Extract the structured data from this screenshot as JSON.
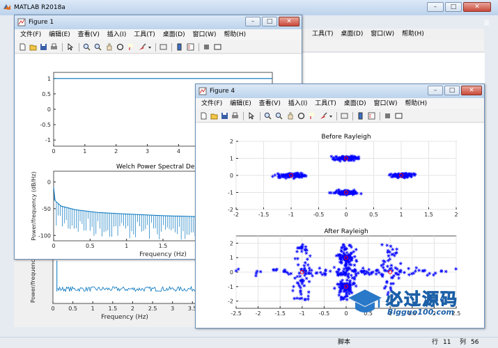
{
  "matlab": {
    "title": "MATLAB R2018a",
    "menu": [
      "工具(T)",
      "桌面(D)",
      "窗口(W)",
      "帮助(H)"
    ],
    "status": {
      "script": "脚本",
      "row_label": "行",
      "row": "11",
      "col_label": "列",
      "col": "56"
    },
    "side_text": "录"
  },
  "figure1": {
    "title": "Figure 1",
    "menu": [
      "文件(F)",
      "编辑(E)",
      "查看(V)",
      "插入(I)",
      "工具(T)",
      "桌面(D)",
      "窗口(W)",
      "帮助(H)"
    ]
  },
  "figure4": {
    "title": "Figure 4",
    "menu": [
      "文件(F)",
      "编辑(E)",
      "查看(V)",
      "插入(I)",
      "工具(T)",
      "桌面(D)",
      "窗口(W)",
      "帮助(H)"
    ]
  },
  "watermark": {
    "text": "必过源码",
    "url": "Bigguo100.com"
  },
  "colors": {
    "line": "#0072bd",
    "scatter": "#0000ff",
    "marker": "#ff0000",
    "frame": "#6b8fb5"
  },
  "chart_data": [
    {
      "id": "fig1-top",
      "type": "line",
      "x": [
        0,
        7
      ],
      "y": [
        1,
        1
      ],
      "xticks": [
        "0",
        "1",
        "2",
        "3",
        "4",
        "5",
        "6"
      ],
      "yticks": [
        "-1",
        "-0.5",
        "0",
        "0.5",
        "1"
      ],
      "xlim": [
        0,
        7
      ],
      "ylim": [
        -1.2,
        1.2
      ]
    },
    {
      "id": "fig1-psd",
      "type": "line",
      "title": "Welch Power Spectral Density",
      "xlabel": "Frequency (Hz)",
      "ylabel": "Power/frequency (dB/Hz)",
      "xticks": [
        "0",
        "0.5",
        "1",
        "1.5",
        "2",
        "2.5",
        "3"
      ],
      "yticks": [
        "-100",
        "-50",
        "0"
      ],
      "xlim": [
        0,
        3
      ],
      "ylim": [
        -110,
        20
      ],
      "series": [
        {
          "x": [
            0,
            0.02,
            0.1,
            0.3,
            0.6,
            1.0,
            1.5,
            2.0,
            2.5,
            3.0
          ],
          "y": [
            -10,
            -35,
            -45,
            -52,
            -57,
            -60,
            -63,
            -65,
            -66,
            -67
          ]
        }
      ]
    },
    {
      "id": "main-bottom",
      "type": "line",
      "xlabel": "Frequency (Hz)",
      "ylabel": "Power/frequenc",
      "xticks": [
        "0",
        "0.5",
        "1",
        "1.5",
        "2",
        "2.5",
        "3",
        "3.5"
      ],
      "xlim": [
        0,
        3.6
      ],
      "ylim": [
        -130,
        0
      ],
      "series": [
        {
          "x": [
            0,
            3.6
          ],
          "y": [
            -88,
            -88
          ]
        }
      ]
    },
    {
      "id": "fig4-before",
      "type": "scatter",
      "title": "Before Rayleigh",
      "xticks": [
        "-2",
        "-1.5",
        "-1",
        "-0.5",
        "0",
        "0.5",
        "1",
        "1.5",
        "2"
      ],
      "yticks": [
        "-2",
        "-1",
        "0",
        "1",
        "2"
      ],
      "xlim": [
        -2,
        2
      ],
      "ylim": [
        -2,
        2
      ],
      "clusters": [
        {
          "x": -1,
          "y": 0
        },
        {
          "x": 1,
          "y": 0
        },
        {
          "x": 0,
          "y": 1
        },
        {
          "x": 0,
          "y": -1
        }
      ]
    },
    {
      "id": "fig4-after",
      "type": "scatter",
      "title": "After Rayleigh",
      "xticks": [
        "-2.5",
        "-2",
        "-1.5",
        "-1",
        "-0.5",
        "0",
        "0.5",
        "1",
        "1.5",
        "2",
        "2.5"
      ],
      "yticks": [
        "-2",
        "-1",
        "0",
        "1",
        "2"
      ],
      "xlim": [
        -2.5,
        2.5
      ],
      "ylim": [
        -2.5,
        2.5
      ],
      "clusters": [
        {
          "x": -1,
          "y": 0
        },
        {
          "x": 1,
          "y": 0
        },
        {
          "x": 0,
          "y": 1
        },
        {
          "x": 0,
          "y": -1
        }
      ]
    }
  ]
}
